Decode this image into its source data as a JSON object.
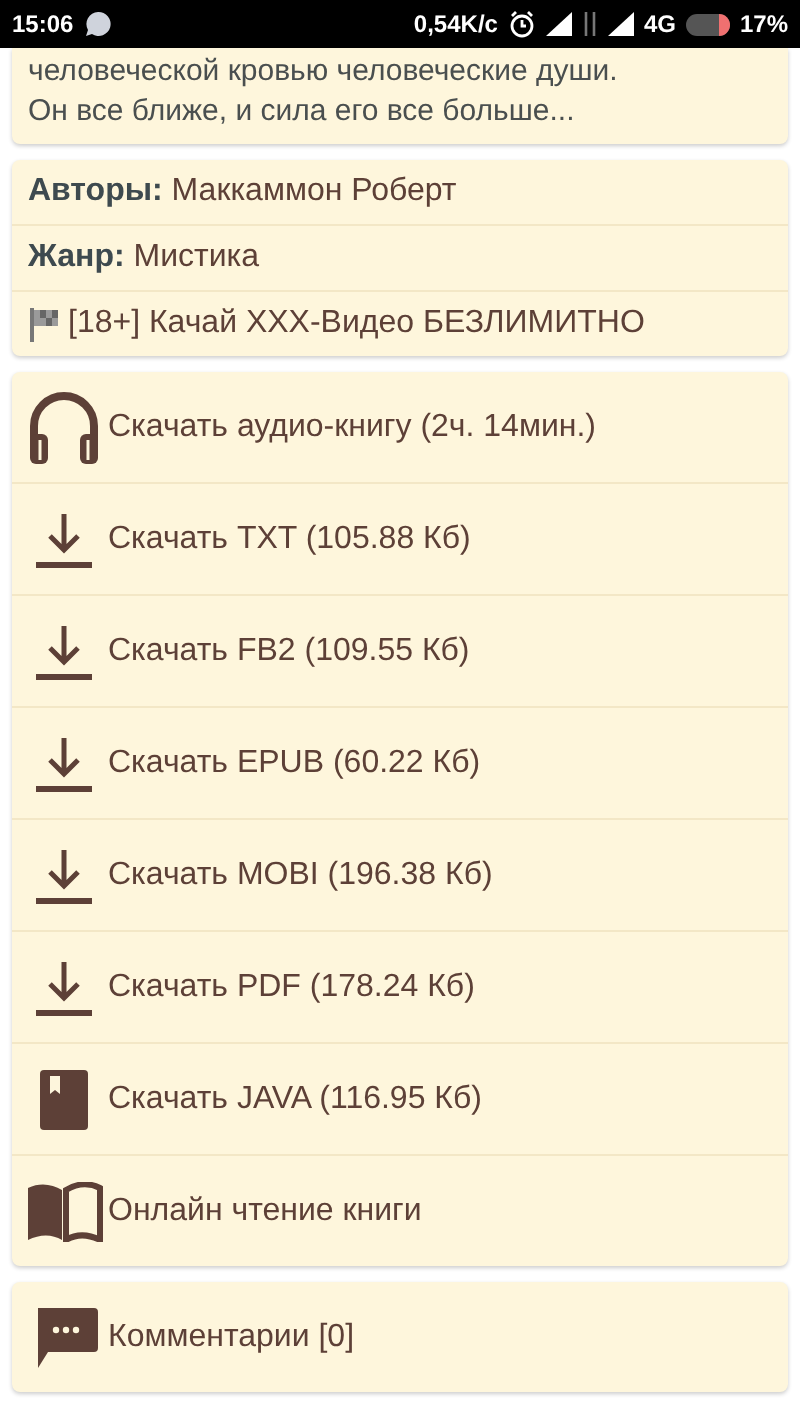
{
  "status_bar": {
    "time": "15:06",
    "speed": "0,54K/с",
    "network": "4G",
    "battery": "17%"
  },
  "description": [
    "человеческой кровью человеческие души.",
    "Он все ближе, и сила его все больше..."
  ],
  "info": [
    {
      "kind": "field",
      "label": "Авторы:",
      "value": "Маккаммон Роберт"
    },
    {
      "kind": "field",
      "label": "Жанр:",
      "value": "Мистика"
    },
    {
      "kind": "ad",
      "value": "[18+] Качай XXX-Видео БЕЗЛИМИТНО"
    }
  ],
  "downloads": [
    {
      "kind": "audio",
      "label": "Скачать аудио-книгу (2ч. 14мин.)"
    },
    {
      "kind": "download",
      "label": "Скачать TXT (105.88 Кб)"
    },
    {
      "kind": "download",
      "label": "Скачать FB2 (109.55 Кб)"
    },
    {
      "kind": "download",
      "label": "Скачать EPUB (60.22 Кб)"
    },
    {
      "kind": "download",
      "label": "Скачать MOBI (196.38 Кб)"
    },
    {
      "kind": "download",
      "label": "Скачать PDF (178.24 Кб)"
    },
    {
      "kind": "java",
      "label": "Скачать JAVA (116.95 Кб)"
    },
    {
      "kind": "read",
      "label": "Онлайн чтение книги"
    }
  ],
  "comments": {
    "label": "Комментарии [0]"
  }
}
